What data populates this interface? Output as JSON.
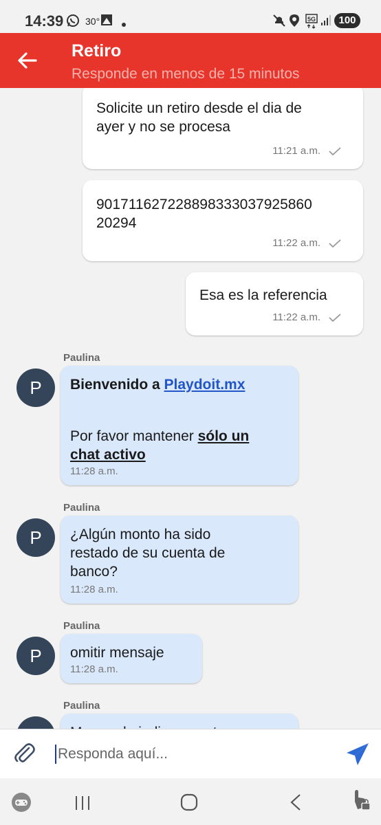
{
  "status_bar": {
    "time": "14:39",
    "temperature": "30°",
    "battery": "100"
  },
  "header": {
    "title": "Retiro",
    "subtitle": "Responde en menos de 15 minutos"
  },
  "messages": {
    "out1": {
      "line1": "Solicite un retiro desde el dia de",
      "line2": "ayer y no se procesa",
      "time": "11:21 a.m."
    },
    "out2": {
      "line1": "901711627228898333037925860",
      "line2": "20294",
      "time": "11:22 a.m."
    },
    "out3": {
      "text": "Esa es la referencia",
      "time": "11:22 a.m."
    },
    "in1": {
      "sender": "Paulina",
      "avatar_letter": "P",
      "welcome_prefix": "Bienvenido a ",
      "welcome_link": "Playdoit.mx",
      "request_prefix": "Por favor mantener ",
      "request_emphasis_1": "sólo un",
      "request_emphasis_2": "chat activo",
      "time": "11:28 a.m."
    },
    "in2": {
      "sender": "Paulina",
      "avatar_letter": "P",
      "line1": "¿Algún monto ha sido",
      "line2": "restado de su cuenta de",
      "line3": "banco?",
      "time": "11:28 a.m."
    },
    "in3": {
      "sender": "Paulina",
      "avatar_letter": "P",
      "text": "omitir mensaje",
      "time": "11:28 a.m."
    },
    "in4": {
      "sender": "Paulina",
      "avatar_letter": "P",
      "text": "Me puede indicar monto"
    }
  },
  "composer": {
    "placeholder": "Responda aquí..."
  },
  "colors": {
    "header": "#e8352c",
    "incoming_bubble": "#d9e8fb",
    "avatar": "#344459",
    "send": "#2e6ad6"
  }
}
